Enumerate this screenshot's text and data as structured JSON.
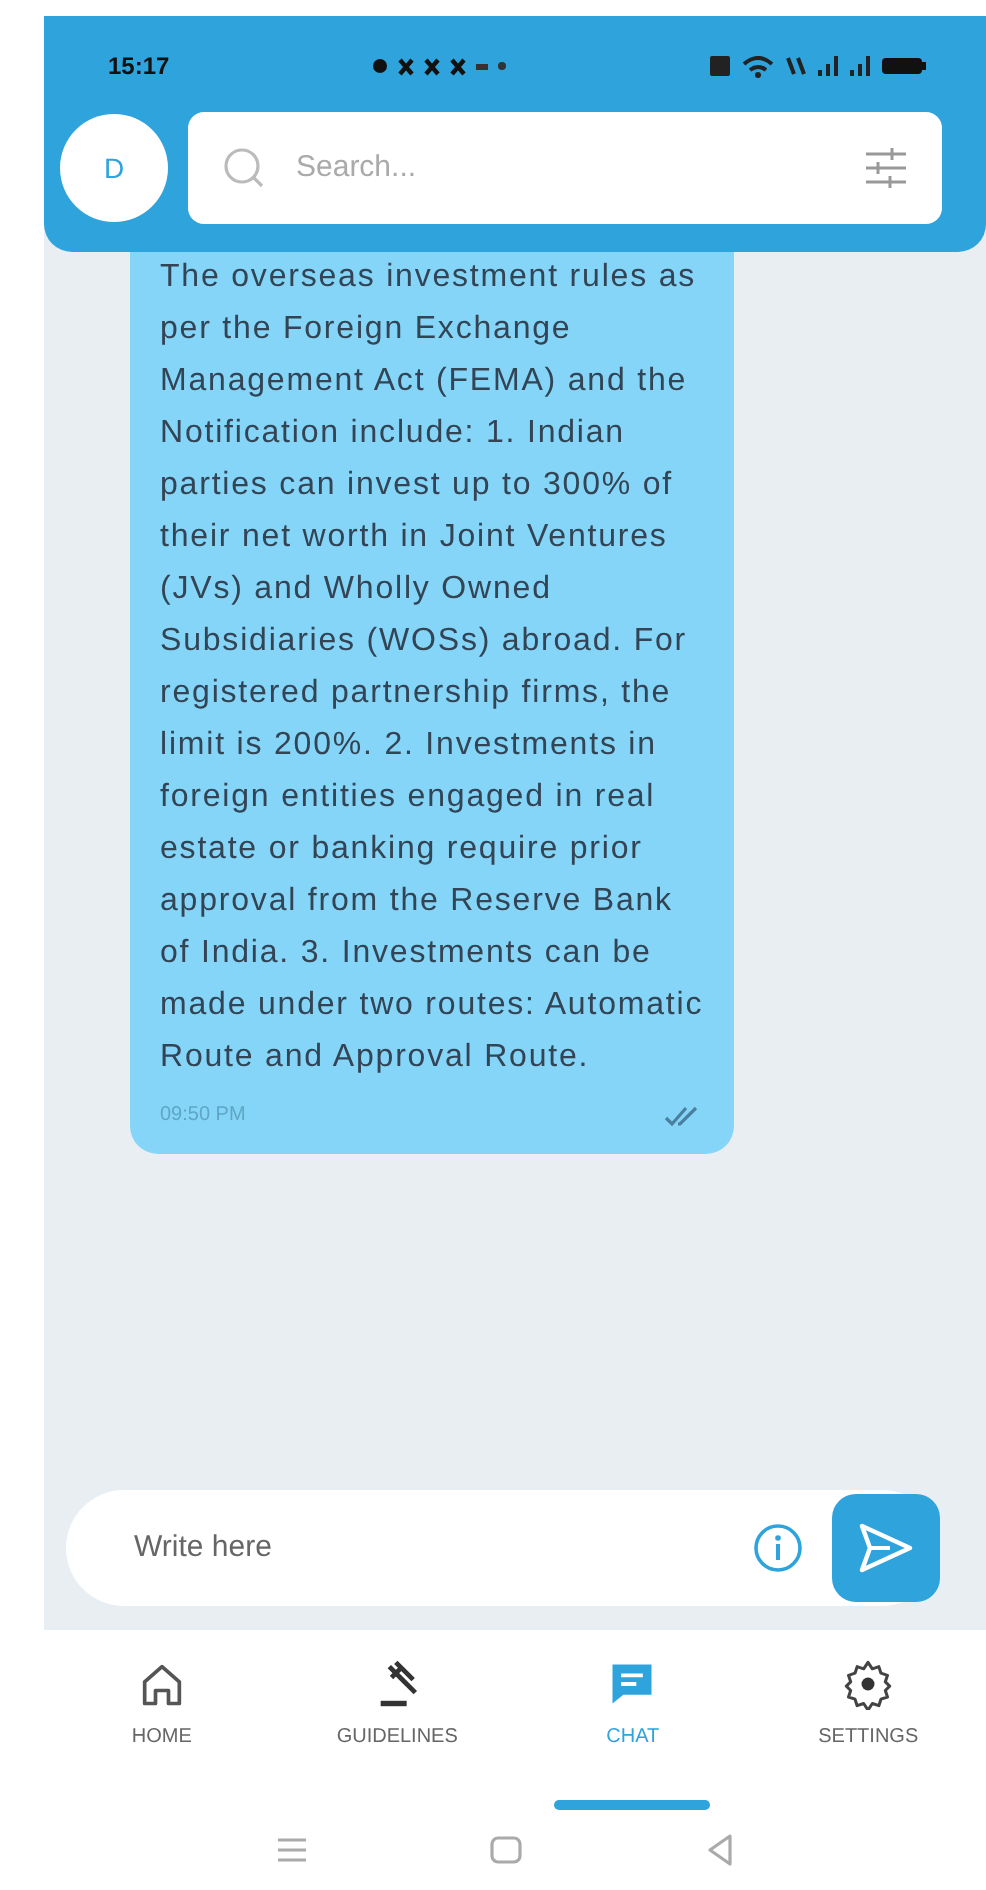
{
  "status_bar": {
    "time": "15:17"
  },
  "header": {
    "avatar_letter": "D",
    "search": {
      "placeholder": "Search..."
    }
  },
  "messages": [
    {
      "text": "The overseas investment rules as per the Foreign Exchange Management Act (FEMA) and the Notification include: 1. Indian parties can invest up to 300% of their net worth in Joint Ventures (JVs) and Wholly Owned Subsidiaries (WOSs) abroad. For registered partnership firms, the limit is 200%. 2. Investments in foreign entities engaged in real estate or banking require prior approval from the Reserve Bank of India. 3. Investments can be made under two routes: Automatic Route and Approval Route.",
      "time": "09:50 PM",
      "read": true
    }
  ],
  "composer": {
    "placeholder": "Write here"
  },
  "nav": [
    {
      "label": "HOME",
      "selected": false
    },
    {
      "label": "GUIDELINES",
      "selected": false
    },
    {
      "label": "CHAT",
      "selected": true
    },
    {
      "label": "SETTINGS",
      "selected": false
    }
  ]
}
